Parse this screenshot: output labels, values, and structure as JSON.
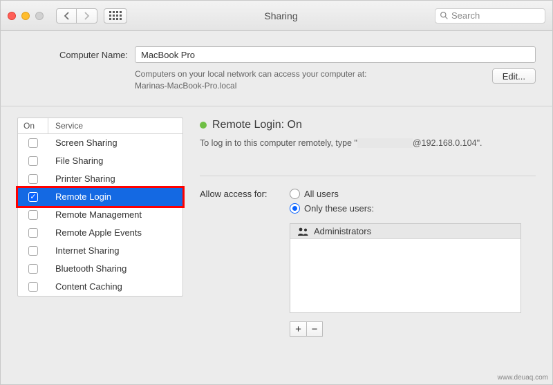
{
  "window": {
    "title": "Sharing",
    "search_placeholder": "Search"
  },
  "computer_name": {
    "label": "Computer Name:",
    "value": "MacBook Pro",
    "description_line1": "Computers on your local network can access your computer at:",
    "description_line2": "Marinas-MacBook-Pro.local",
    "edit_label": "Edit..."
  },
  "services": {
    "col_on": "On",
    "col_service": "Service",
    "items": [
      {
        "label": "Screen Sharing",
        "checked": false,
        "selected": false
      },
      {
        "label": "File Sharing",
        "checked": false,
        "selected": false
      },
      {
        "label": "Printer Sharing",
        "checked": false,
        "selected": false
      },
      {
        "label": "Remote Login",
        "checked": true,
        "selected": true
      },
      {
        "label": "Remote Management",
        "checked": false,
        "selected": false
      },
      {
        "label": "Remote Apple Events",
        "checked": false,
        "selected": false
      },
      {
        "label": "Internet Sharing",
        "checked": false,
        "selected": false
      },
      {
        "label": "Bluetooth Sharing",
        "checked": false,
        "selected": false
      },
      {
        "label": "Content Caching",
        "checked": false,
        "selected": false
      }
    ]
  },
  "status": {
    "title_prefix": "Remote Login: ",
    "title_state": "On",
    "help_prefix": "To log in to this computer remotely, type \"",
    "help_user": "",
    "help_host": "@192.168.0.104",
    "help_suffix": "\"."
  },
  "access": {
    "label": "Allow access for:",
    "all_users": "All users",
    "only_these": "Only these users:",
    "selected": "only",
    "users_header": "Administrators"
  },
  "buttons": {
    "add": "+",
    "remove": "−"
  },
  "watermark": "www.deuaq.com"
}
